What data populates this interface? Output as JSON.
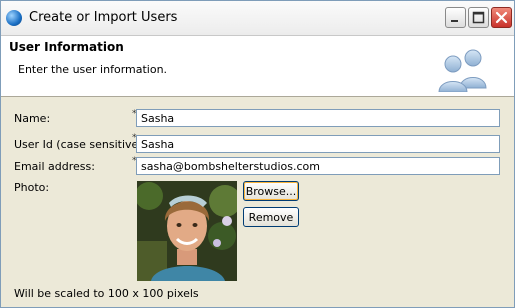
{
  "window": {
    "title": "Create or Import Users",
    "controls": [
      "minimize-icon",
      "maximize-icon",
      "close-icon"
    ]
  },
  "banner": {
    "title": "User Information",
    "description": "Enter the user information.",
    "icon": "users-icon"
  },
  "form": {
    "name_label": "Name:",
    "name_value": "Sasha",
    "userid_label": "User Id (case sensitive):",
    "userid_value": "Sasha",
    "email_label": "Email address:",
    "email_value": "sasha@bombshelterstudios.com",
    "photo_label": "Photo:",
    "required_marker": "*",
    "browse_label": "Browse...",
    "remove_label": "Remove",
    "scale_note": "Will be scaled to 100 x 100 pixels"
  },
  "colors": {
    "border": "#7f9db9",
    "window_bg": "#ece9d8",
    "close_button": "#c9322b"
  }
}
